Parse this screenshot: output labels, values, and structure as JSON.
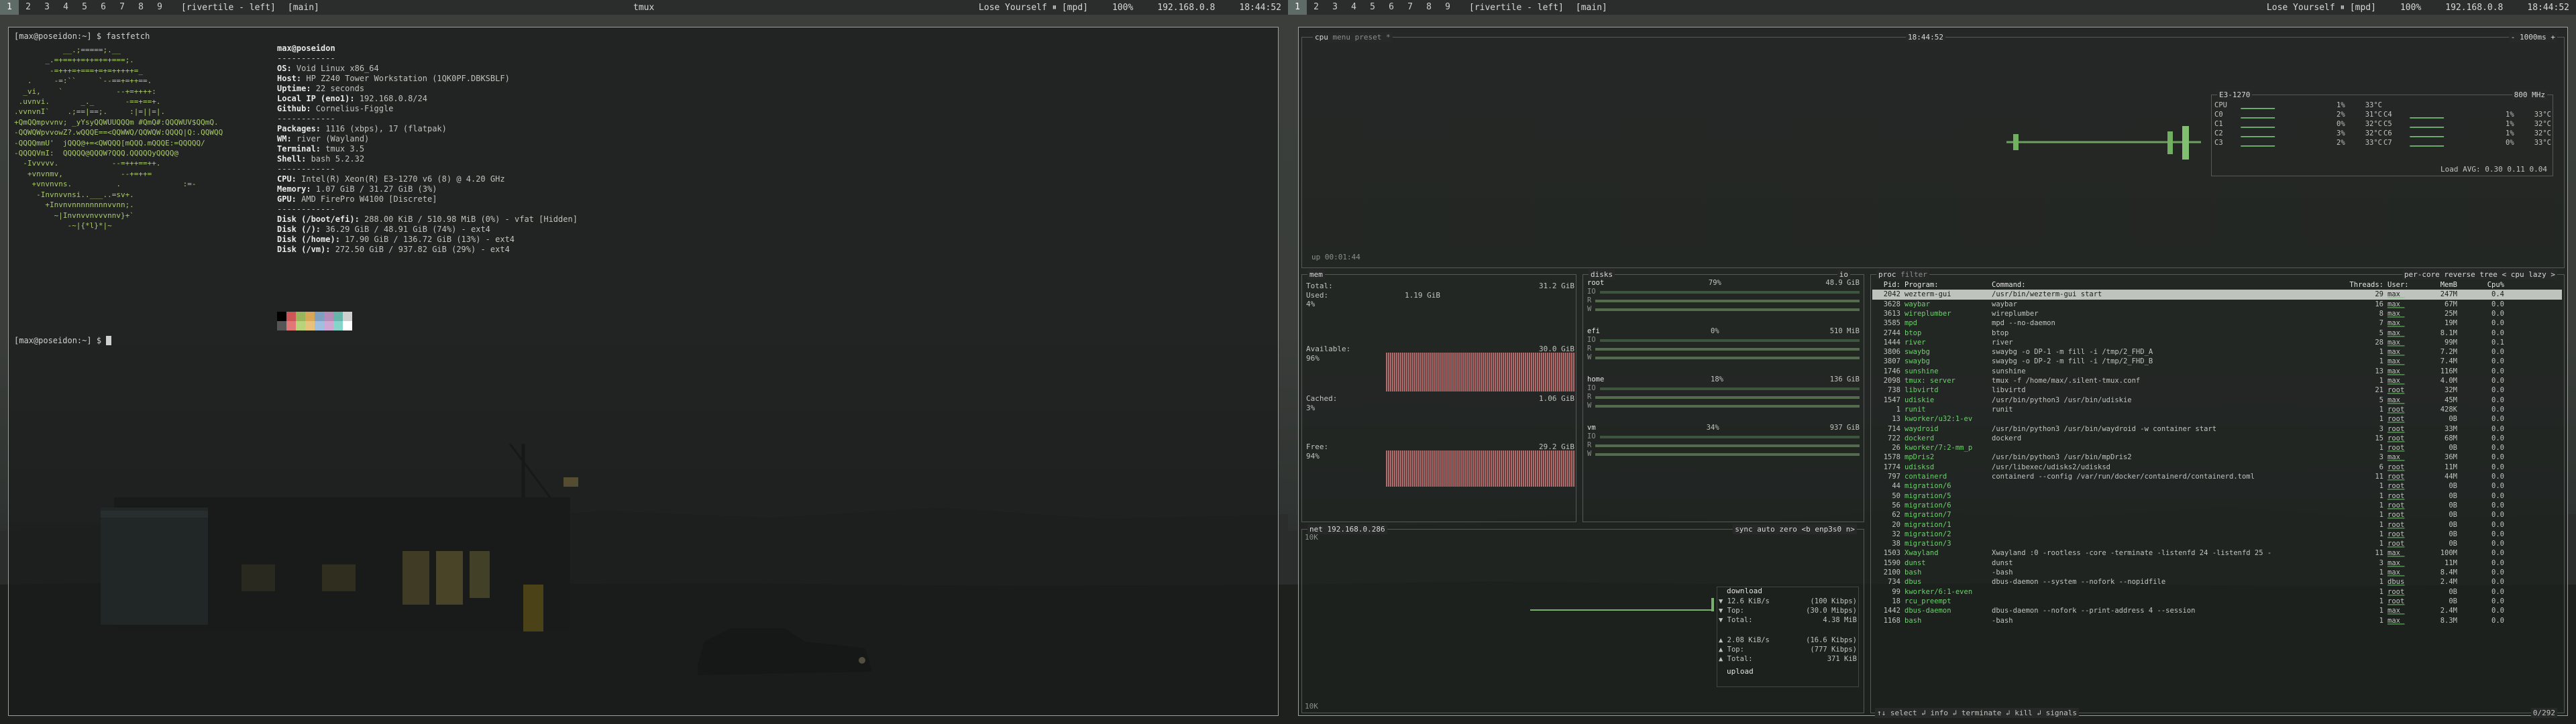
{
  "left_bar": {
    "tags": [
      "1",
      "2",
      "3",
      "4",
      "5",
      "6",
      "7",
      "8",
      "9"
    ],
    "active_tag": 0,
    "layout": "[rivertile - left]",
    "view": "[main]",
    "window_title": "tmux",
    "song": "Lose Yourself ⏸ [mpd]",
    "volume": "100%",
    "ip": "192.168.0.8",
    "time": "18:44:52"
  },
  "right_bar": {
    "tags": [
      "1",
      "2",
      "3",
      "4",
      "5",
      "6",
      "7",
      "8",
      "9"
    ],
    "active_tag": 0,
    "layout": "[rivertile - left]",
    "view": "[main]",
    "song": "Lose Yourself ⏸ [mpd]",
    "volume": "100%",
    "ip": "192.168.0.8",
    "time": "18:44:52"
  },
  "terminal": {
    "prompt1": "[max@poseidon:~] $ fastfetch",
    "prompt2": "[max@poseidon:~] $ ",
    "user_host": "max@poseidon",
    "separator": "------------",
    "logo": [
      "           __.;=====;.__",
      "       _.=+==++=++=+=+===;.",
      "        -=+++=+===+=+=+++++=_",
      "   .     -=:``     `--==+=++==.",
      "  _vi,    `            --+=++++:",
      " .uvnvi.       _._       -==+==+.",
      ".vvnvnI`    .;==|==;.     :|=||=|.",
      "+QmQQmpvvnv; _yYsyQQWUUQQQm #QmQ#:QQQWUV$QQmQ.",
      "-QQWQWpvvowZ?.wQQQE==<QQWWQ/QQWQW:QQQQ|Q:.QQWQQ",
      "-QQQQmmU'  jQQQ@+=<QWQQQ[mQQQ.mQQQE:=QQQQQ/",
      "-QQQQVmI:  QQQQQ@QQQW?QQQ.QQQQQyQQQQ@",
      "  -Ivvvvv.            --=+++==++.",
      "   +vnvnmv,             --+=++=",
      "    +vnvnvns.          .              :=-",
      "     -Invnvvnsi..___..=sv+.",
      "       +Invnvnnnnnnnnvvnn;.",
      "         ~|Invnvvnvvvnnv}+`",
      "            -~|{*l}*|~"
    ],
    "info": [
      {
        "k": "",
        "v": "max@poseidon"
      },
      {
        "k": "",
        "v": "------------"
      },
      {
        "k": "OS",
        "v": "Void Linux x86_64"
      },
      {
        "k": "Host",
        "v": "HP Z240 Tower Workstation (1QK0PF.DBKSBLF)"
      },
      {
        "k": "Uptime",
        "v": "22 seconds"
      },
      {
        "k": "Local IP (eno1)",
        "v": "192.168.0.8/24"
      },
      {
        "k": "Github",
        "v": "Cornelius-Figgle"
      },
      {
        "k": "",
        "v": "------------"
      },
      {
        "k": "Packages",
        "v": "1116 (xbps), 17 (flatpak)"
      },
      {
        "k": "WM",
        "v": "river (Wayland)"
      },
      {
        "k": "Terminal",
        "v": "tmux 3.5"
      },
      {
        "k": "Shell",
        "v": "bash 5.2.32"
      },
      {
        "k": "",
        "v": "------------"
      },
      {
        "k": "CPU",
        "v": "Intel(R) Xeon(R) E3-1270 v6 (8) @ 4.20 GHz"
      },
      {
        "k": "Memory",
        "v": "1.07 GiB / 31.27 GiB (3%)"
      },
      {
        "k": "GPU",
        "v": "AMD FirePro W4100 [Discrete]"
      },
      {
        "k": "",
        "v": "------------"
      },
      {
        "k": "Disk (/boot/efi)",
        "v": "288.00 KiB / 510.98 MiB (0%) - vfat [Hidden]"
      },
      {
        "k": "Disk (/)",
        "v": "36.29 GiB / 48.91 GiB (74%) - ext4"
      },
      {
        "k": "Disk (/home)",
        "v": "17.90 GiB / 136.72 GiB (13%) - ext4"
      },
      {
        "k": "Disk (/vm)",
        "v": "272.50 GiB / 937.82 GiB (29%) - ext4"
      }
    ],
    "palette_top": [
      "#000000",
      "#cc5555",
      "#99b55b",
      "#d8a657",
      "#7d9fc0",
      "#b58bb8",
      "#66b5aa",
      "#d0d0d0"
    ],
    "palette_bottom": [
      "#555555",
      "#e07878",
      "#b7d47a",
      "#e8c27a",
      "#9fbfe0",
      "#d0a6d3",
      "#86d5ca",
      "#ffffff"
    ]
  },
  "btop": {
    "cpu": {
      "title": "cpu",
      "menu": "menu",
      "preset": "preset *",
      "clock": "18:44:52",
      "refresh": "- 1000ms +",
      "model": "E3-1270",
      "freq": "800 MHz",
      "uptime": "up 00:01:44",
      "cores": [
        {
          "n": "CPU",
          "p": "1%",
          "t": "33°C"
        },
        {
          "n": "C0",
          "p": "2%",
          "t": "31°C"
        },
        {
          "n": "C1",
          "p": "0%",
          "t": "32°C"
        },
        {
          "n": "C2",
          "p": "3%",
          "t": "32°C"
        },
        {
          "n": "C3",
          "p": "2%",
          "t": "33°C"
        }
      ],
      "cores2": [
        {
          "n": "C4",
          "p": "1%",
          "t": "33°C"
        },
        {
          "n": "C5",
          "p": "1%",
          "t": "32°C"
        },
        {
          "n": "C6",
          "p": "1%",
          "t": "32°C"
        },
        {
          "n": "C7",
          "p": "0%",
          "t": "33°C"
        }
      ],
      "load": "Load AVG:   0.30   0.11   0.04"
    },
    "mem": {
      "title": "mem",
      "total_l": "Total:",
      "total_v": "31.2 GiB",
      "used_l": "Used:",
      "used_v": "1.19 GiB",
      "used_p": "4%",
      "avail_l": "Available:",
      "avail_v": "30.0 GiB",
      "avail_p": "96%",
      "cached_l": "Cached:",
      "cached_v": "1.06 GiB",
      "cached_p": "3%",
      "free_l": "Free:",
      "free_v": "29.2 GiB",
      "free_p": "94%"
    },
    "disks": {
      "title": "disks",
      "io": "io",
      "list": [
        {
          "n": "root",
          "p": "79%",
          "s": "48.9 GiB"
        },
        {
          "n": "efi",
          "p": "0%",
          "s": "510 MiB"
        },
        {
          "n": "home",
          "p": "18%",
          "s": "136 GiB"
        },
        {
          "n": "vm",
          "p": "34%",
          "s": "937 GiB"
        }
      ]
    },
    "net": {
      "title": "net",
      "iface_ip": "192.168.0.286",
      "opts": "sync  auto  zero  <b enp3s0 n>",
      "scale_top": "10K",
      "scale_bot": "10K",
      "download": "download",
      "dl": [
        {
          "k": "▼ 12.6 KiB/s",
          "v": "(100 Kibps)"
        },
        {
          "k": "▼ Top:",
          "v": "(30.0 Mibps)"
        },
        {
          "k": "▼ Total:",
          "v": "4.38 MiB"
        }
      ],
      "ul": [
        {
          "k": "▲ 2.08 KiB/s",
          "v": "(16.6 Kibps)"
        },
        {
          "k": "▲ Top:",
          "v": "(777 Kibps)"
        },
        {
          "k": "▲ Total:",
          "v": "371 KiB"
        }
      ],
      "upload": "upload"
    },
    "proc": {
      "title": "proc",
      "filter": "filter",
      "opts": "per-core  reverse  tree  < cpu lazy >",
      "cols": [
        "Pid:",
        "Program:",
        "Command:",
        "Threads:",
        "User:",
        "MemB",
        "Cpu%"
      ],
      "rows": [
        [
          "2042",
          "wezterm-gui",
          "/usr/bin/wezterm-gui start",
          "29",
          "max",
          "247M",
          "0.4"
        ],
        [
          "3628",
          "waybar",
          "waybar",
          "16",
          "max",
          "67M",
          "0.0"
        ],
        [
          "3613",
          "wireplumber",
          "wireplumber",
          "8",
          "max",
          "25M",
          "0.0"
        ],
        [
          "3585",
          "mpd",
          "mpd --no-daemon",
          "7",
          "max",
          "19M",
          "0.0"
        ],
        [
          "2744",
          "btop",
          "btop",
          "5",
          "max",
          "8.1M",
          "0.0"
        ],
        [
          "1444",
          "river",
          "river",
          "28",
          "max",
          "99M",
          "0.1"
        ],
        [
          "3806",
          "swaybg",
          "swaybg -o DP-1 -m fill -i /tmp/2_FHD_A",
          "1",
          "max",
          "7.2M",
          "0.0"
        ],
        [
          "3807",
          "swaybg",
          "swaybg -o DP-2 -m fill -i /tmp/2_FHD_B",
          "1",
          "max",
          "7.4M",
          "0.0"
        ],
        [
          "1746",
          "sunshine",
          "sunshine",
          "13",
          "max",
          "116M",
          "0.0"
        ],
        [
          "2098",
          "tmux: server",
          "tmux -f /home/max/.silent-tmux.conf",
          "1",
          "max",
          "4.0M",
          "0.0"
        ],
        [
          "738",
          "libvirtd",
          "libvirtd",
          "21",
          "root",
          "32M",
          "0.0"
        ],
        [
          "1547",
          "udiskie",
          "/usr/bin/python3 /usr/bin/udiskie",
          "5",
          "max",
          "45M",
          "0.0"
        ],
        [
          "1",
          "runit",
          "runit",
          "1",
          "root",
          "428K",
          "0.0"
        ],
        [
          "13",
          "kworker/u32:1-ev",
          "",
          "1",
          "root",
          "0B",
          "0.0"
        ],
        [
          "714",
          "waydroid",
          "/usr/bin/python3 /usr/bin/waydroid -w container start",
          "3",
          "root",
          "33M",
          "0.0"
        ],
        [
          "722",
          "dockerd",
          "dockerd",
          "15",
          "root",
          "68M",
          "0.0"
        ],
        [
          "26",
          "kworker/7:2-mm_p",
          "",
          "1",
          "root",
          "0B",
          "0.0"
        ],
        [
          "1578",
          "mpDris2",
          "/usr/bin/python3 /usr/bin/mpDris2",
          "3",
          "max",
          "36M",
          "0.0"
        ],
        [
          "1774",
          "udisksd",
          "/usr/libexec/udisks2/udisksd",
          "6",
          "root",
          "11M",
          "0.0"
        ],
        [
          "797",
          "containerd",
          "containerd --config /var/run/docker/containerd/containerd.toml",
          "11",
          "root",
          "44M",
          "0.0"
        ],
        [
          "44",
          "migration/6",
          "",
          "1",
          "root",
          "0B",
          "0.0"
        ],
        [
          "50",
          "migration/5",
          "",
          "1",
          "root",
          "0B",
          "0.0"
        ],
        [
          "56",
          "migration/6",
          "",
          "1",
          "root",
          "0B",
          "0.0"
        ],
        [
          "62",
          "migration/7",
          "",
          "1",
          "root",
          "0B",
          "0.0"
        ],
        [
          "20",
          "migration/1",
          "",
          "1",
          "root",
          "0B",
          "0.0"
        ],
        [
          "32",
          "migration/2",
          "",
          "1",
          "root",
          "0B",
          "0.0"
        ],
        [
          "38",
          "migration/3",
          "",
          "1",
          "root",
          "0B",
          "0.0"
        ],
        [
          "1503",
          "Xwayland",
          "Xwayland :0 -rootless -core -terminate -listenfd 24 -listenfd 25 -",
          "11",
          "max",
          "100M",
          "0.0"
        ],
        [
          "1590",
          "dunst",
          "dunst",
          "3",
          "max",
          "11M",
          "0.0"
        ],
        [
          "2100",
          "bash",
          "-bash",
          "1",
          "max",
          "8.4M",
          "0.0"
        ],
        [
          "734",
          "dbus",
          "dbus-daemon --system --nofork --nopidfile",
          "1",
          "dbus",
          "2.4M",
          "0.0"
        ],
        [
          "99",
          "kworker/6:1-even",
          "",
          "1",
          "root",
          "0B",
          "0.0"
        ],
        [
          "18",
          "rcu_preempt",
          "",
          "1",
          "root",
          "0B",
          "0.0"
        ],
        [
          "1442",
          "dbus-daemon",
          "dbus-daemon --nofork --print-address 4 --session",
          "1",
          "max",
          "2.4M",
          "0.0"
        ],
        [
          "1168",
          "bash",
          "-bash",
          "1",
          "max",
          "8.3M",
          "0.0"
        ]
      ],
      "footer": "↑↓ select ↲ info ↲ terminate ↲ kill ↲ signals",
      "count": "0/292"
    }
  }
}
